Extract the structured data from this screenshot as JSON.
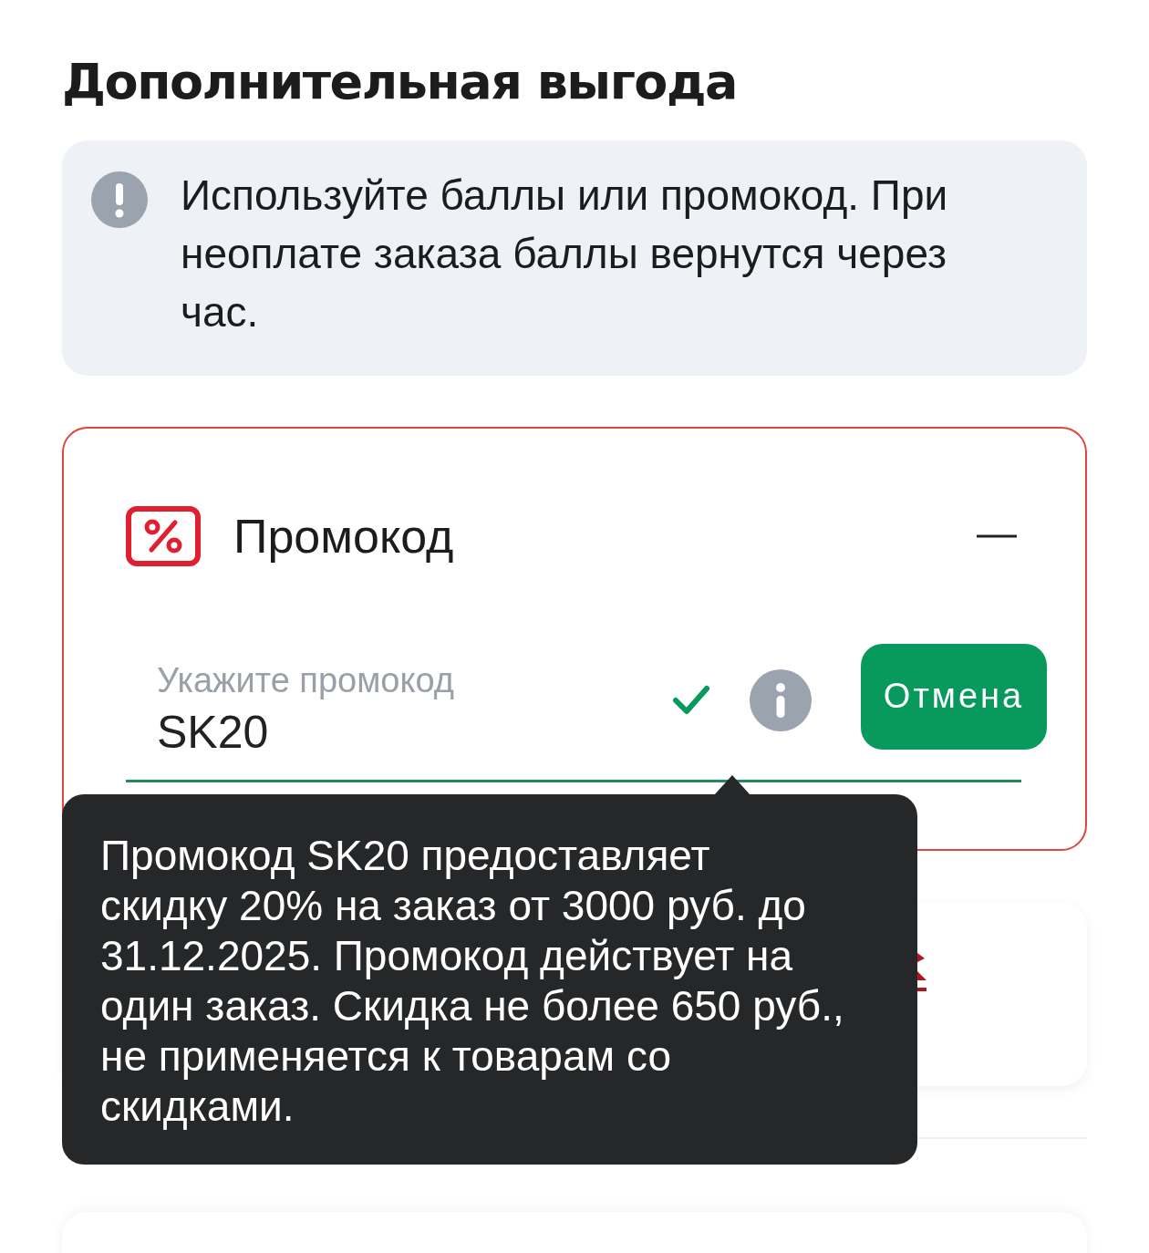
{
  "title": "Дополнительная выгода",
  "notice": {
    "text": "Используйте баллы или промокод. При неоплате заказа баллы вернутся через час."
  },
  "promo": {
    "title": "Промокод",
    "expanded": true,
    "field": {
      "label": "Укажите промокод",
      "value": "SK20",
      "valid": true
    },
    "cancel_button": "Отмена"
  },
  "tooltip": {
    "text": "Промокод SK20 предоставляет скидку 20% на заказ от 3000 руб. до 31.12.2025. Промокод действует на один заказ. Скидка не более 650 руб., не применяется к товарам со скидками."
  }
}
